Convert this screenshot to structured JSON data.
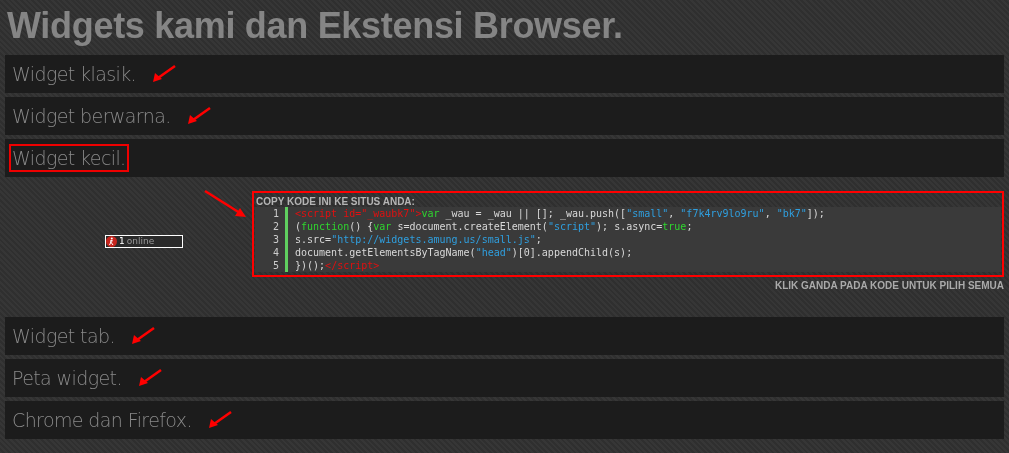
{
  "title": "Widgets kami dan Ekstensi Browser.",
  "sections": [
    {
      "label": "Widget klasik.",
      "arrow_marked": true,
      "boxed": false
    },
    {
      "label": "Widget berwarna.",
      "arrow_marked": true,
      "boxed": false
    },
    {
      "label": "Widget kecil.",
      "arrow_marked": false,
      "boxed": true,
      "preview": {
        "count": "1",
        "text": "online"
      },
      "code_panel": {
        "arrow_marked": true,
        "boxed": true,
        "heading": "COPY KODE INI KE SITUS ANDA:",
        "hint": "KLIK GANDA PADA KODE UNTUK PILIH SEMUA",
        "lines": [
          {
            "number": "1",
            "tokens": [
              {
                "kind": "tag",
                "text": "<script id=\"_waubk7\">"
              },
              {
                "kind": "keyword",
                "text": "var"
              },
              {
                "kind": "plain",
                "text": " _wau = _wau || []; _wau.push(["
              },
              {
                "kind": "string",
                "text": "\"small\""
              },
              {
                "kind": "plain",
                "text": ", "
              },
              {
                "kind": "string",
                "text": "\"f7k4rv9lo9ru\""
              },
              {
                "kind": "plain",
                "text": ", "
              },
              {
                "kind": "string",
                "text": "\"bk7\""
              },
              {
                "kind": "plain",
                "text": "]);"
              }
            ]
          },
          {
            "number": "2",
            "tokens": [
              {
                "kind": "plain",
                "text": "("
              },
              {
                "kind": "keyword",
                "text": "function"
              },
              {
                "kind": "plain",
                "text": "() {"
              },
              {
                "kind": "keyword",
                "text": "var"
              },
              {
                "kind": "plain",
                "text": " s=document.createElement("
              },
              {
                "kind": "string",
                "text": "\"script\""
              },
              {
                "kind": "plain",
                "text": "); s.async="
              },
              {
                "kind": "keyword",
                "text": "true"
              },
              {
                "kind": "plain",
                "text": ";"
              }
            ]
          },
          {
            "number": "3",
            "tokens": [
              {
                "kind": "plain",
                "text": "s.src="
              },
              {
                "kind": "string",
                "text": "\"http://widgets.amung.us/small.js\""
              },
              {
                "kind": "plain",
                "text": ";"
              }
            ]
          },
          {
            "number": "4",
            "tokens": [
              {
                "kind": "plain",
                "text": "document.getElementsByTagName("
              },
              {
                "kind": "string",
                "text": "\"head\""
              },
              {
                "kind": "plain",
                "text": ")[0].appendChild(s);"
              }
            ]
          },
          {
            "number": "5",
            "tokens": [
              {
                "kind": "plain",
                "text": "})();"
              },
              {
                "kind": "tag",
                "text": "</script>"
              }
            ]
          }
        ]
      }
    },
    {
      "label": "Widget tab.",
      "arrow_marked": true,
      "boxed": false
    },
    {
      "label": "Peta widget.",
      "arrow_marked": true,
      "boxed": false
    },
    {
      "label": "Chrome dan Firefox.",
      "arrow_marked": true,
      "boxed": false
    }
  ]
}
